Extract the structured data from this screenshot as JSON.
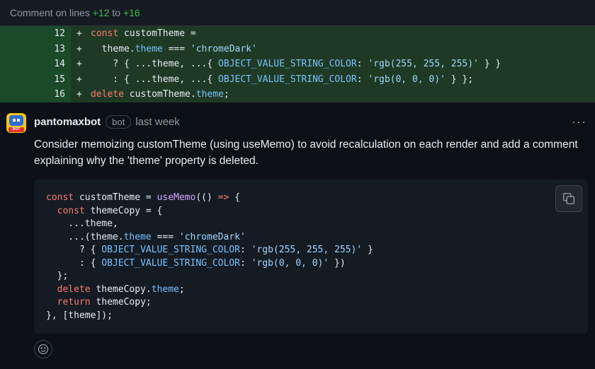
{
  "header": {
    "prefix": "Comment on lines",
    "start": "+12",
    "middle": "to",
    "end": "+16"
  },
  "diff": {
    "lines": [
      {
        "num": "12",
        "sign": "+"
      },
      {
        "num": "13",
        "sign": "+"
      },
      {
        "num": "14",
        "sign": "+"
      },
      {
        "num": "15",
        "sign": "+"
      },
      {
        "num": "16",
        "sign": "+"
      }
    ],
    "t": {
      "const": "const",
      "customTheme_eq": " customTheme =",
      "indent13": "  theme.",
      "theme": "theme",
      "eqeqeq": " === ",
      "chromeDark": "'chromeDark'",
      "l14a": "    ? { ...theme, ...{ ",
      "key": "OBJECT_VALUE_STRING_COLOR",
      "colon": ": ",
      "white": "'rgb(255, 255, 255)'",
      "l14b": " } }",
      "l15a": "    : { ...theme, ...{ ",
      "black": "'rgb(0, 0, 0)'",
      "l15b": " } };",
      "delete": "delete",
      "l16a": " customTheme.",
      "semi": ";"
    }
  },
  "comment": {
    "author": "pantomaxbot",
    "badge": "bot",
    "time": "last week",
    "more": "···",
    "avatar_text": "BOT",
    "body": "Consider memoizing customTheme (using useMemo) to avoid recalculation on each render and add a comment explaining why the 'theme' property is deleted."
  },
  "code": {
    "const": "const",
    "customTheme_eq": " customTheme = ",
    "useMemo": "useMemo",
    "arrow_open": "(() ",
    "arrow": "=>",
    "brace": " {",
    "themeCopy_eq": " themeCopy = {",
    "spread_theme": "    ...theme,",
    "spread_open": "    ...(theme.",
    "theme": "theme",
    "eqeqeq": " === ",
    "chromeDark": "'chromeDark'",
    "q_open": "      ? { ",
    "key": "OBJECT_VALUE_STRING_COLOR",
    "colon": ": ",
    "white": "'rgb(255, 255, 255)'",
    "close1": " }",
    "c_open": "      : { ",
    "black": "'rgb(0, 0, 0)'",
    "close2": " })",
    "close_obj": "  };",
    "delete": "delete",
    "themeCopy_dot": " themeCopy.",
    "semi": ";",
    "return": "return",
    "ret_val": " themeCopy;",
    "end": "}, [theme]);"
  },
  "colors": {
    "background": "#0d1117",
    "diff_added": "#1e3a25",
    "keyword": "#ff7b72",
    "property": "#79c0ff",
    "string": "#a5d6ff",
    "function": "#d2a8ff"
  }
}
